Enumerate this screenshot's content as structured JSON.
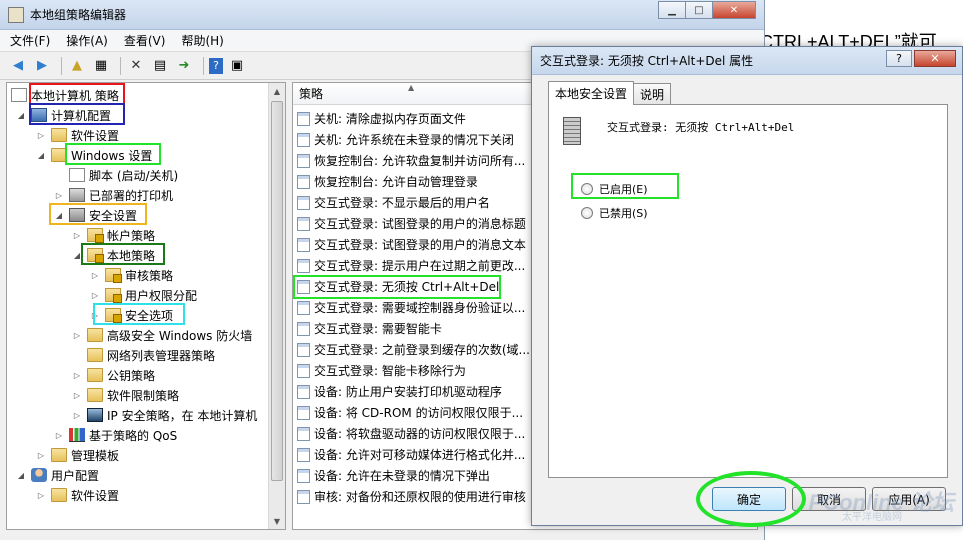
{
  "background_text": "CTRL+ALT+DEL”就可",
  "main_window": {
    "title": "本地组策略编辑器",
    "menu": [
      "文件(F)",
      "操作(A)",
      "查看(V)",
      "帮助(H)"
    ],
    "tree": {
      "root": "本地计算机 策略",
      "computer_config": "计算机配置",
      "software_settings": "软件设置",
      "windows_settings": "Windows 设置",
      "scripts": "脚本 (启动/关机)",
      "printers": "已部署的打印机",
      "security_settings": "安全设置",
      "account_policies": "帐户策略",
      "local_policies": "本地策略",
      "audit_policy": "审核策略",
      "user_rights": "用户权限分配",
      "security_options": "安全选项",
      "firewall": "高级安全 Windows 防火墙",
      "network_list": "网络列表管理器策略",
      "public_key": "公钥策略",
      "software_restriction": "软件限制策略",
      "ip_security": "IP 安全策略，在 本地计算机",
      "qos": "基于策略的 QoS",
      "admin_templates": "管理模板",
      "user_config": "用户配置",
      "user_software_settings": "软件设置"
    },
    "list": {
      "header": "策略",
      "items": [
        "关机: 清除虚拟内存页面文件",
        "关机: 允许系统在未登录的情况下关闭",
        "恢复控制台: 允许软盘复制并访问所有...",
        "恢复控制台: 允许自动管理登录",
        "交互式登录: 不显示最后的用户名",
        "交互式登录: 试图登录的用户的消息标题",
        "交互式登录: 试图登录的用户的消息文本",
        "交互式登录: 提示用户在过期之前更改...",
        "交互式登录: 无须按 Ctrl+Alt+Del",
        "交互式登录: 需要域控制器身份验证以...",
        "交互式登录: 需要智能卡",
        "交互式登录: 之前登录到缓存的次数(域...",
        "交互式登录: 智能卡移除行为",
        "设备: 防止用户安装打印机驱动程序",
        "设备: 将 CD-ROM 的访问权限仅限于...",
        "设备: 将软盘驱动器的访问权限仅限于...",
        "设备: 允许对可移动媒体进行格式化并...",
        "设备: 允许在未登录的情况下弹出",
        "审核: 对备份和还原权限的使用进行审核"
      ]
    }
  },
  "dialog": {
    "title": "交互式登录: 无须按 Ctrl+Alt+Del 属性",
    "help": "?",
    "tabs": [
      "本地安全设置",
      "说明"
    ],
    "policy_name": "交互式登录: 无须按 Ctrl+Alt+Del",
    "options": [
      "已启用(E)",
      "已禁用(S)"
    ],
    "selected_option": "已启用(E)",
    "buttons": {
      "ok": "确定",
      "cancel": "取消",
      "apply": "应用(A)"
    }
  },
  "watermark": {
    "main": "PConline 论坛",
    "sub": "太平洋电脑网"
  },
  "highlight_colors": {
    "red": "#e8141a",
    "blue": "#2424b4",
    "green": "#22e22a",
    "orange": "#f0b41e",
    "darkgreen": "#1a7a1a",
    "cyan": "#2ee0e8"
  }
}
